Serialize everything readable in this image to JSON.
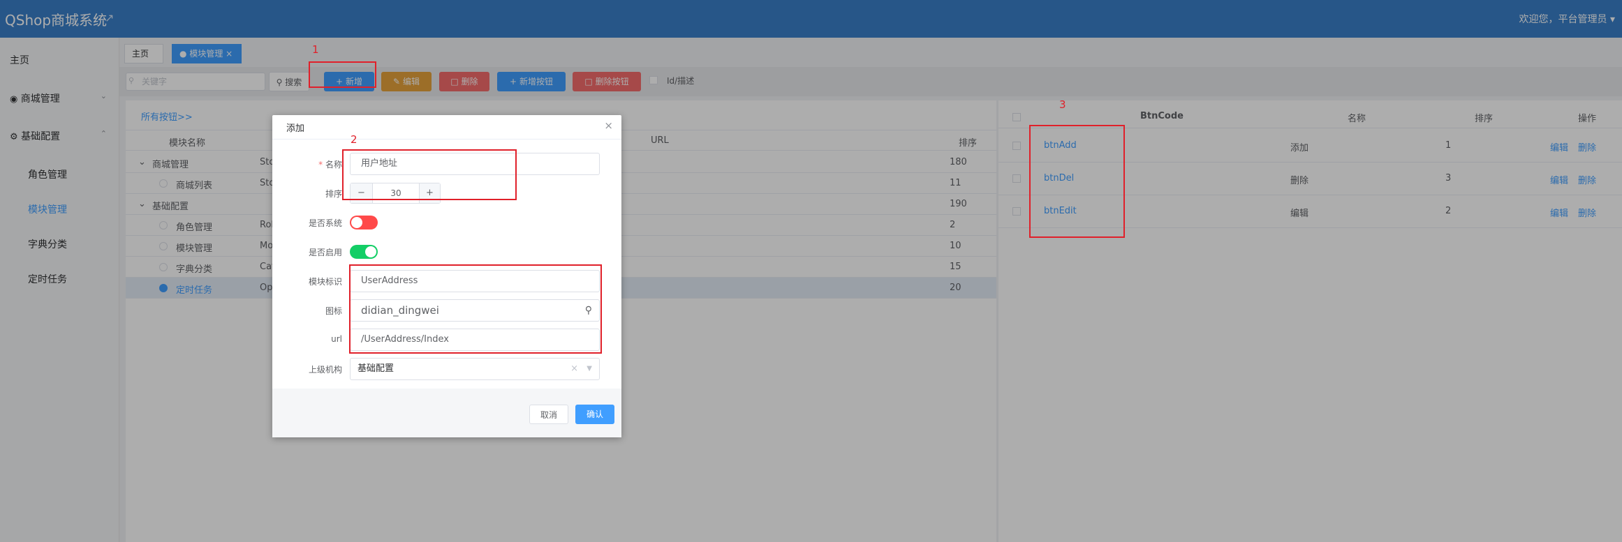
{
  "header": {
    "title": "QShop商城系统",
    "welcome": "欢迎您，平台管理员"
  },
  "sidebar": {
    "home": "主页",
    "shop": "商城管理",
    "basic": "基础配置",
    "sub": [
      "角色管理",
      "模块管理",
      "字典分类",
      "定时任务"
    ]
  },
  "tabs": [
    "主页",
    "模块管理"
  ],
  "toolbar": {
    "search_placeholder": "关键字",
    "search": "搜索",
    "add": "新增",
    "edit": "编辑",
    "del": "删除",
    "add_btn": "新增按钮",
    "del_btn": "删除按钮",
    "id_desc": "Id/描述"
  },
  "left": {
    "all_link": "所有按钮>>",
    "cols": [
      "模块名称",
      "URL",
      "排序"
    ],
    "rows": [
      {
        "name": "商城管理",
        "code": "Sto",
        "sort": "180",
        "level": 0
      },
      {
        "name": "商城列表",
        "code": "Sto",
        "sort": "11",
        "level": 1
      },
      {
        "name": "基础配置",
        "code": "",
        "sort": "190",
        "level": 0
      },
      {
        "name": "角色管理",
        "code": "Rol",
        "sort": "2",
        "level": 1
      },
      {
        "name": "模块管理",
        "code": "Mo",
        "sort": "10",
        "level": 1
      },
      {
        "name": "字典分类",
        "code": "Cat",
        "sort": "15",
        "level": 1
      },
      {
        "name": "定时任务",
        "code": "Op",
        "sort": "20",
        "level": 1
      }
    ]
  },
  "right": {
    "cols": [
      "BtnCode",
      "名称",
      "排序",
      "操作"
    ],
    "rows": [
      {
        "code": "btnAdd",
        "name": "添加",
        "sort": "1"
      },
      {
        "code": "btnDel",
        "name": "删除",
        "sort": "3"
      },
      {
        "code": "btnEdit",
        "name": "编辑",
        "sort": "2"
      }
    ],
    "edit": "编辑",
    "del": "删除"
  },
  "dialog": {
    "title": "添加",
    "name_label": "名称",
    "name_value": "用户地址",
    "sort_label": "排序",
    "sort_value": "30",
    "is_system_label": "是否系统",
    "is_enabled_label": "是否启用",
    "module_label": "模块标识",
    "module_value": "UserAddress",
    "icon_label": "图标",
    "icon_value": "didian_dingwei",
    "url_label": "url",
    "url_value": "/UserAddress/Index",
    "parent_label": "上级机构",
    "parent_value": "基础配置",
    "cancel": "取消",
    "confirm": "确认"
  },
  "annotations": [
    "1",
    "2",
    "3"
  ],
  "colors": {
    "header": "#3a7fc9",
    "primary": "#409eff",
    "danger": "#f56c6c",
    "warning": "#e6a23c",
    "switch_on": "#13ce66",
    "switch_off": "#ff4949",
    "annotation": "#e0202a"
  },
  "icons": {
    "pin": "pin-icon",
    "location": "location-icon"
  }
}
